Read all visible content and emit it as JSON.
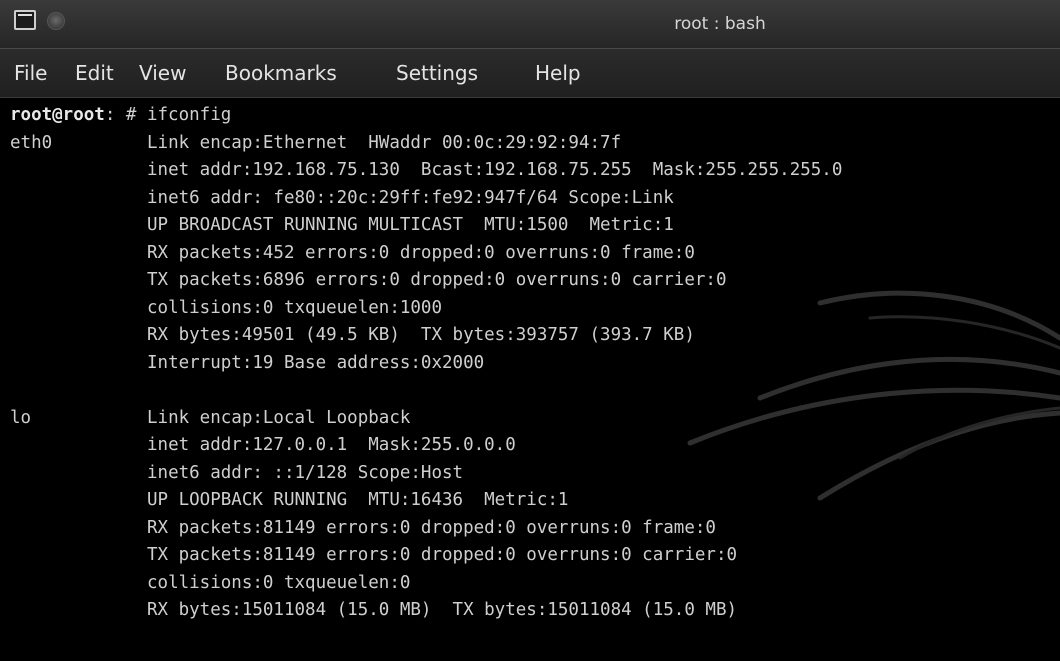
{
  "window": {
    "title": "root : bash"
  },
  "menu": [
    "File",
    "Edit",
    "View",
    "Bookmarks",
    "Settings",
    "Help"
  ],
  "terminal": {
    "prompt_user": "root@root",
    "prompt_rest": ": # ",
    "command": "ifconfig",
    "lines": [
      {
        "iface": "eth0",
        "text": "Link encap:Ethernet  HWaddr 00:0c:29:92:94:7f"
      },
      {
        "iface": "",
        "text": "inet addr:192.168.75.130  Bcast:192.168.75.255  Mask:255.255.255.0"
      },
      {
        "iface": "",
        "text": "inet6 addr: fe80::20c:29ff:fe92:947f/64 Scope:Link"
      },
      {
        "iface": "",
        "text": "UP BROADCAST RUNNING MULTICAST  MTU:1500  Metric:1"
      },
      {
        "iface": "",
        "text": "RX packets:452 errors:0 dropped:0 overruns:0 frame:0"
      },
      {
        "iface": "",
        "text": "TX packets:6896 errors:0 dropped:0 overruns:0 carrier:0"
      },
      {
        "iface": "",
        "text": "collisions:0 txqueuelen:1000"
      },
      {
        "iface": "",
        "text": "RX bytes:49501 (49.5 KB)  TX bytes:393757 (393.7 KB)"
      },
      {
        "iface": "",
        "text": "Interrupt:19 Base address:0x2000"
      },
      {
        "iface": "",
        "text": ""
      },
      {
        "iface": "lo",
        "text": "Link encap:Local Loopback"
      },
      {
        "iface": "",
        "text": "inet addr:127.0.0.1  Mask:255.0.0.0"
      },
      {
        "iface": "",
        "text": "inet6 addr: ::1/128 Scope:Host"
      },
      {
        "iface": "",
        "text": "UP LOOPBACK RUNNING  MTU:16436  Metric:1"
      },
      {
        "iface": "",
        "text": "RX packets:81149 errors:0 dropped:0 overruns:0 frame:0"
      },
      {
        "iface": "",
        "text": "TX packets:81149 errors:0 dropped:0 overruns:0 carrier:0"
      },
      {
        "iface": "",
        "text": "collisions:0 txqueuelen:0"
      },
      {
        "iface": "",
        "text": "RX bytes:15011084 (15.0 MB)  TX bytes:15011084 (15.0 MB)"
      }
    ]
  }
}
